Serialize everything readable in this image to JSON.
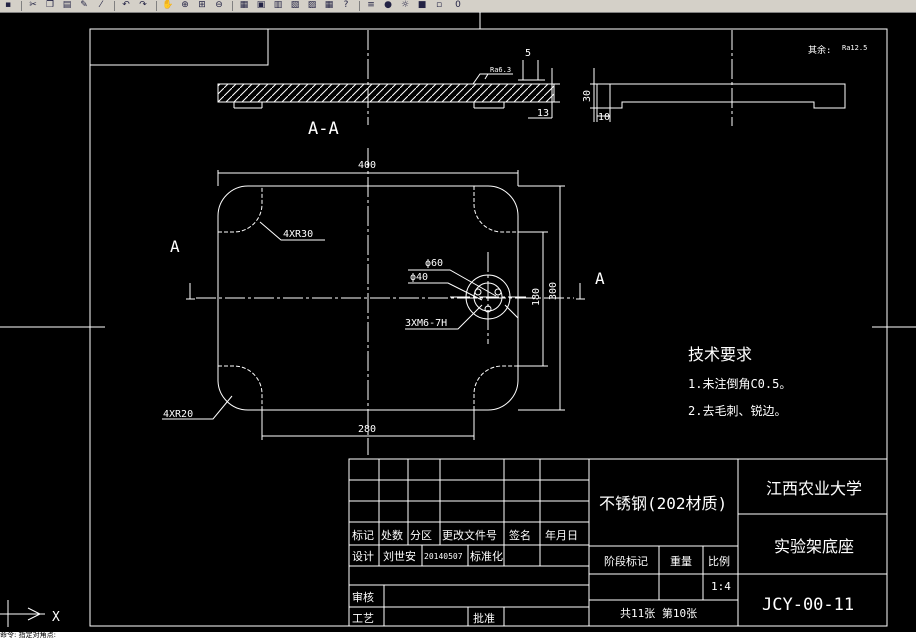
{
  "toolbar": {
    "icons": [
      "save-icon",
      "cut-icon",
      "copy-icon",
      "paste-icon",
      "matchprop-icon",
      "brush-icon",
      "undo-icon",
      "redo-icon",
      "pan-icon",
      "zoom-realtime-icon",
      "zoom-window-icon",
      "zoom-previous-icon",
      "properties-icon",
      "design-center-icon",
      "tool-palettes-icon",
      "sheet-set-icon",
      "markup-icon",
      "calculator-icon",
      "help-icon",
      "layer-manager-icon",
      "lightbulb-icon",
      "sun-icon",
      "layer-color-icon",
      "lock-icon"
    ],
    "layer_value": "0"
  },
  "drawing": {
    "section_label": "A-A",
    "section_marker_left": "A",
    "section_marker_right": "A",
    "roughness_top": "Ra6.3",
    "roughness_rest_prefix": "其余:",
    "roughness_rest": "Ra12.5",
    "dims": {
      "side_thickness": "5",
      "side_step": "13",
      "end_height": "30",
      "end_depth": "10",
      "width_400": "400",
      "width_280": "280",
      "height_300": "300",
      "height_180": "180",
      "corner_r30": "4XR30",
      "corner_r20": "4XR20",
      "dia_60": "ϕ60",
      "dia_40": "ϕ40",
      "thread": "3XM6-7H"
    },
    "tech_req": {
      "title": "技术要求",
      "items": [
        "1.未注倒角C0.5。",
        "2.去毛刺、锐边。"
      ]
    }
  },
  "title_block": {
    "headers": [
      "标记",
      "处数",
      "分区",
      "更改文件号",
      "签名",
      "年月日"
    ],
    "row_design": [
      "设计",
      "刘世安",
      "20140507",
      "标准化"
    ],
    "review": "审核",
    "process": "工艺",
    "approve": "批准",
    "material": "不锈钢(202材质)",
    "stage_mark": "阶段标记",
    "weight": "重量",
    "scale_label": "比例",
    "scale_value": "1:4",
    "sheets": "共11张  第10张",
    "company": "江西农业大学",
    "part_name": "实验架底座",
    "drawing_no": "JCY-00-11"
  },
  "ucs": {
    "x_label": "X"
  },
  "command_line": "命令: 指定对角点:"
}
